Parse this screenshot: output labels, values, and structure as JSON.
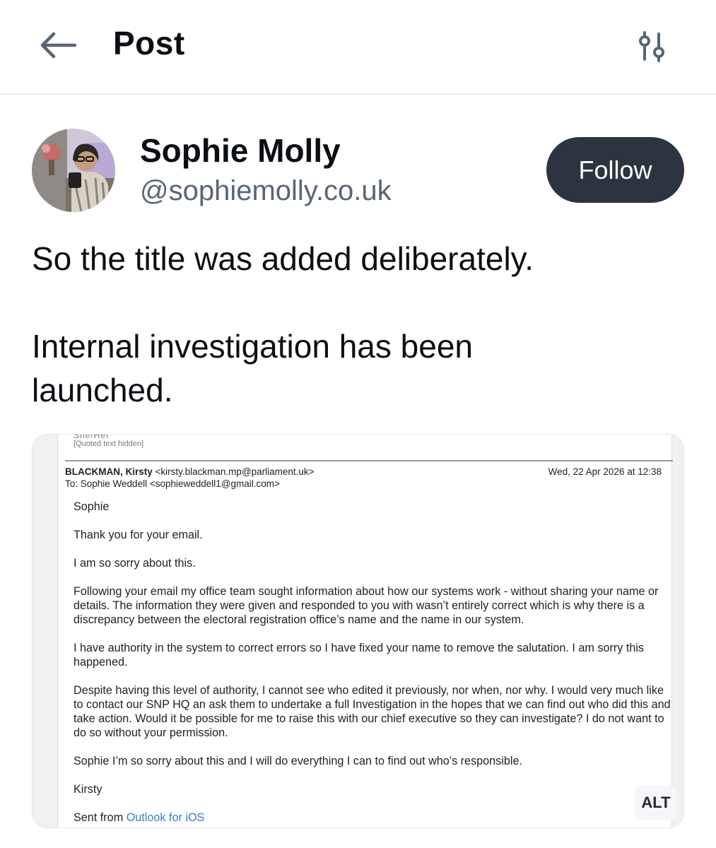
{
  "header": {
    "title": "Post",
    "back_icon": "arrow-left-icon",
    "options_icon": "sliders-icon"
  },
  "author": {
    "name": "Sophie Molly",
    "handle": "@sophiemolly.co.uk",
    "follow_label": "Follow"
  },
  "post": {
    "lines": [
      "So the title was added deliberately.",
      "Internal investigation has been",
      "launched."
    ]
  },
  "media": {
    "alt_label": "ALT",
    "email": {
      "clipped_top": "She/Her",
      "quoted_hidden": "[Quoted text hidden]",
      "from_name": "BLACKMAN, Kirsty",
      "from_address": "<kirsty.blackman.mp@parliament.uk>",
      "to_line": "To: Sophie Weddell <sophieweddell1@gmail.com>",
      "date": "Wed, 22 Apr 2026 at 12:38",
      "paragraphs": [
        "Sophie",
        "Thank you for your email.",
        "I am so sorry about this.",
        "Following your email my office team sought information about how our systems work - without sharing your name or details. The information they were given and responded to you with wasn’t entirely correct which is why there is a discrepancy between the electoral registration office’s name and the name in our system.",
        "I have authority in the system to correct errors so I have fixed your name to remove the salutation. I am sorry this happened.",
        "Despite having this level of authority, I cannot see who edited it previously, nor when, nor why. I would very much like to contact our SNP HQ an ask them to undertake a full Investigation in the hopes that we can find out who did this and take action. Would it be possible for me to raise this with our chief executive so they can investigate? I do not want to do so without your permission.",
        "Sophie I’m so sorry about this and I will do everything I can to find out who’s responsible.",
        "Kirsty"
      ],
      "sent_from_prefix": "Sent from",
      "sent_from_link": "Outlook for iOS"
    }
  },
  "colors": {
    "follow_bg": "#2b3440",
    "handle": "#5a6573",
    "link": "#3a7fc4"
  }
}
